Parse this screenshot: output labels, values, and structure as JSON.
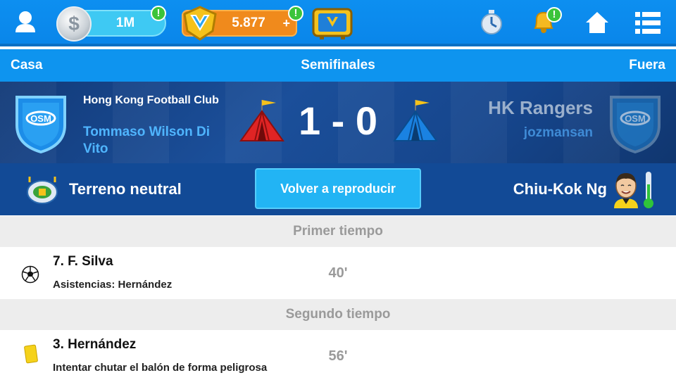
{
  "header": {
    "coins": "1M",
    "gold": "5.877",
    "gold_plus": "+",
    "badge": "!"
  },
  "labels": {
    "home": "Casa",
    "round": "Semifinales",
    "away": "Fuera"
  },
  "match": {
    "home_club": "Hong Kong Football Club",
    "home_manager": "Tommaso Wilson Di Vito",
    "away_club": "HK Rangers",
    "away_manager": "jozmansan",
    "score": "1 - 0"
  },
  "info": {
    "ground": "Terreno neutral",
    "replay_button": "Volver a reproducir",
    "referee": "Chiu-Kok Ng"
  },
  "events": {
    "first_half": "Primer tiempo",
    "second_half": "Segundo tiempo",
    "items": [
      {
        "player": "7. F. Silva",
        "detail": "Asistencias: Hernández",
        "minute": "40'",
        "icon": "soccer-ball-icon"
      },
      {
        "player": "3. Hernández",
        "detail": "Intentar chutar el balón de forma peligrosa",
        "minute": "56'",
        "icon": "yellow-card-icon"
      }
    ]
  },
  "colors": {
    "topbar": "#0d8ff0",
    "score_band": "#1b4f9a",
    "replay_button": "#22b4f4",
    "home_tent": "#e02424",
    "away_tent": "#1a82e2",
    "gold_pill": "#f08a1c",
    "badge": "#3bc43b"
  }
}
